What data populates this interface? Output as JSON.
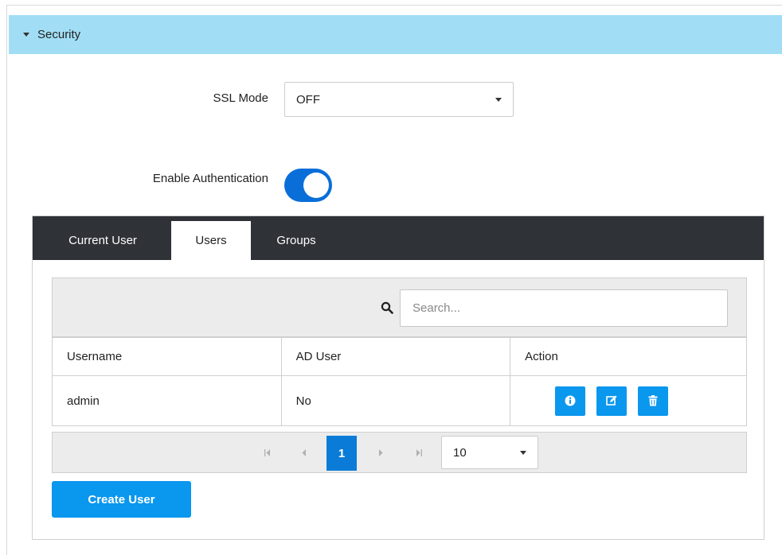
{
  "section": {
    "title": "Security",
    "expanded": true
  },
  "ssl": {
    "label": "SSL Mode",
    "value": "OFF"
  },
  "auth": {
    "label": "Enable Authentication",
    "enabled": true
  },
  "tabs": [
    {
      "label": "Current User",
      "active": false
    },
    {
      "label": "Users",
      "active": true
    },
    {
      "label": "Groups",
      "active": false
    }
  ],
  "search": {
    "placeholder": "Search...",
    "value": ""
  },
  "table": {
    "headers": [
      "Username",
      "AD User",
      "Action"
    ],
    "rows": [
      {
        "username": "admin",
        "ad_user": "No",
        "actions": [
          "info-icon",
          "edit-icon",
          "trash-icon"
        ]
      }
    ]
  },
  "pagination": {
    "current_page": "1",
    "page_size": "10"
  },
  "create_user": {
    "label": "Create User"
  },
  "colors": {
    "header_bg": "#a1def5",
    "tabbar_bg": "#2f3237",
    "accent": "#0a97ee",
    "toggle_on": "#0a6ed8",
    "page_current": "#0a7cd8"
  }
}
